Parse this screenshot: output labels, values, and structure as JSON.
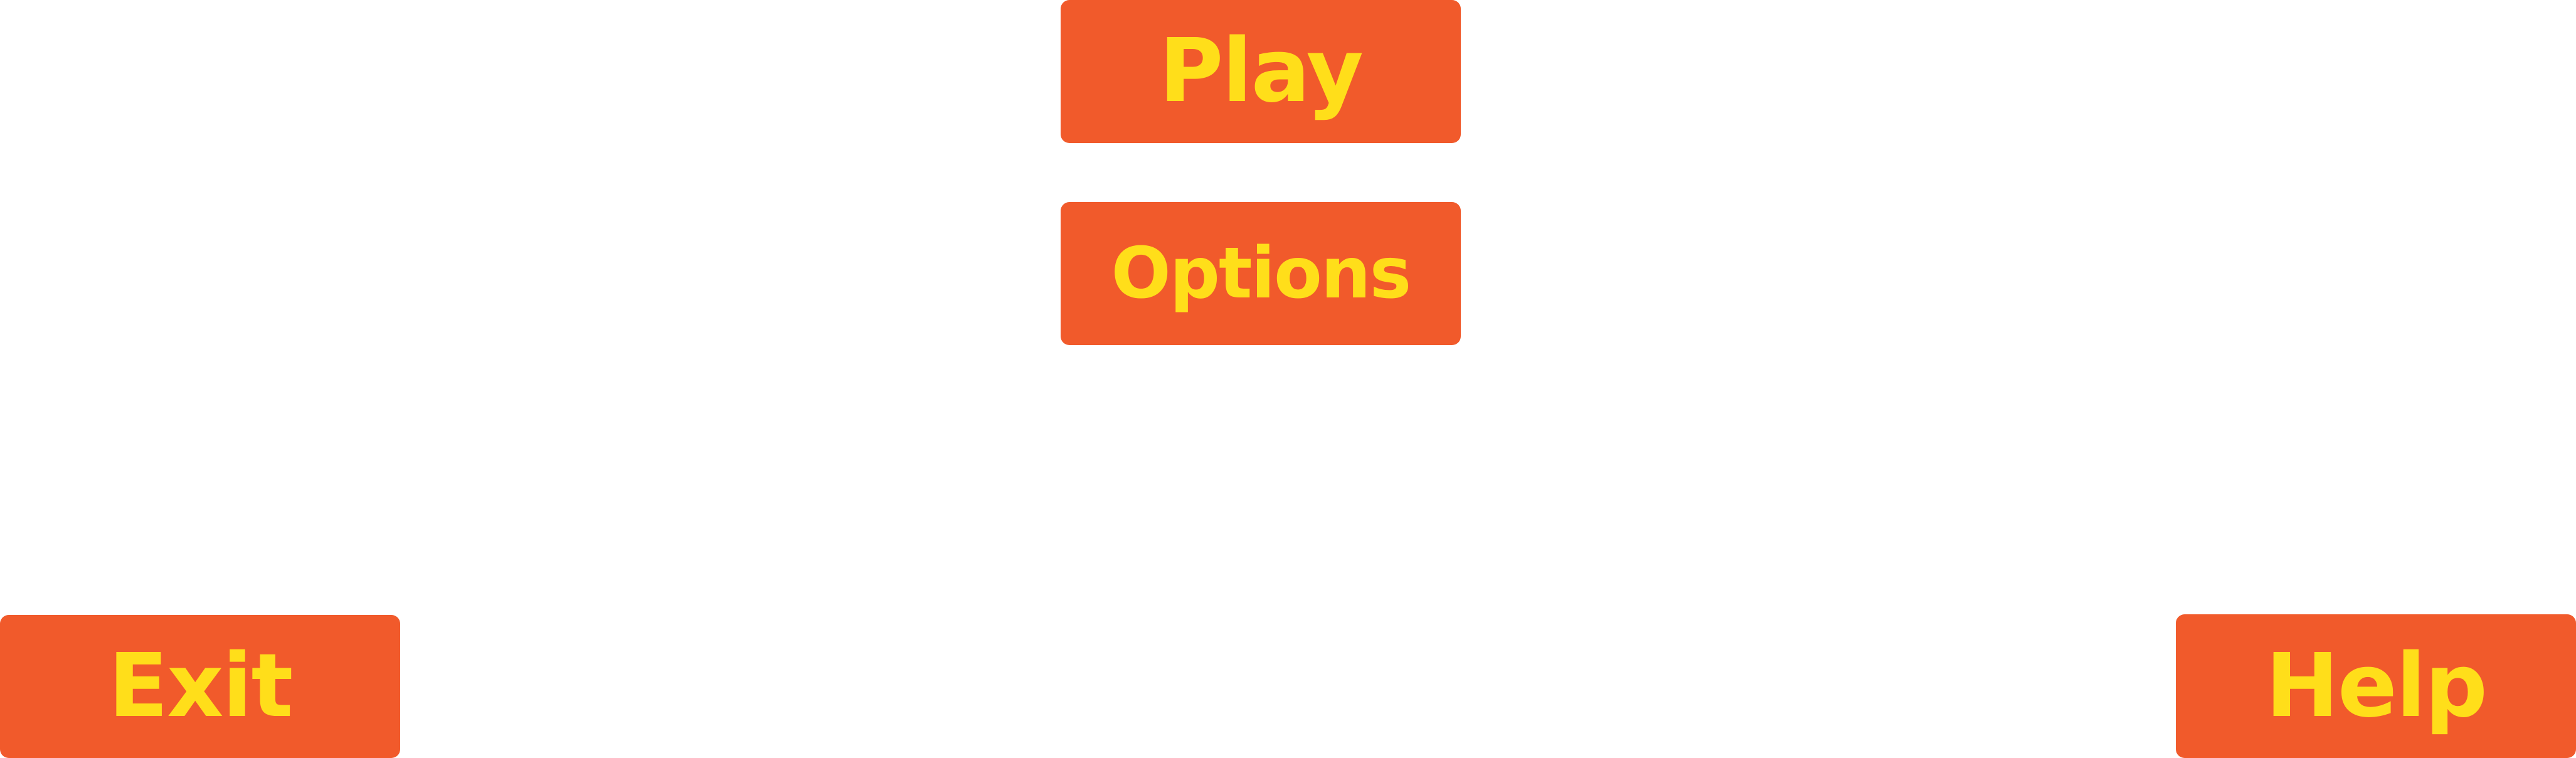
{
  "menu": {
    "play_label": "Play",
    "options_label": "Options",
    "exit_label": "Exit",
    "help_label": "Help"
  },
  "colors": {
    "button_bg": "#f15a2b",
    "button_text": "#ffde1a",
    "background": "#ffffff"
  }
}
